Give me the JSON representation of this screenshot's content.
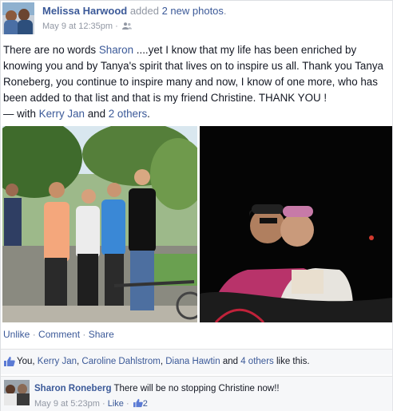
{
  "post": {
    "author": "Melissa Harwood",
    "action_prefix": " added ",
    "action_link": "2 new photos",
    "action_suffix": ".",
    "timestamp": "May 9 at 12:35pm",
    "meta_sep": " · ",
    "audience_icon": "friends-icon",
    "text_part1": "There are no words ",
    "mention": "Sharon",
    "text_part2": " ....yet I know that my life has been enriched by knowing you and by Tanya's spirit that lives on to inspire us all. Thank you Tanya Roneberg, you continue to inspire many and now, I know of one more, who has been added to that list and that is my friend Christine. THANK YOU !",
    "with_prefix": "— with ",
    "with_person": "Kerry Jan",
    "with_and": " and ",
    "with_others": "2 others",
    "with_end": "."
  },
  "actions": {
    "unlike": "Unlike",
    "comment": "Comment",
    "share": "Share",
    "sep": " · "
  },
  "likes": {
    "you": "You, ",
    "names": [
      "Kerry Jan",
      "Caroline Dahlstrom",
      "Diana Hawtin"
    ],
    "comma": ", ",
    "and": " and ",
    "others": "4 others",
    "suffix": " like this."
  },
  "comment": {
    "author": "Sharon Roneberg",
    "text": "There will be no stopping Christine now!!",
    "timestamp": "May 9 at 5:23pm",
    "sep": " · ",
    "like_label": "Like",
    "like_count": "2"
  },
  "colors": {
    "link": "#3b5998",
    "muted": "#9197a3",
    "bar_bg": "#f6f7f9"
  }
}
